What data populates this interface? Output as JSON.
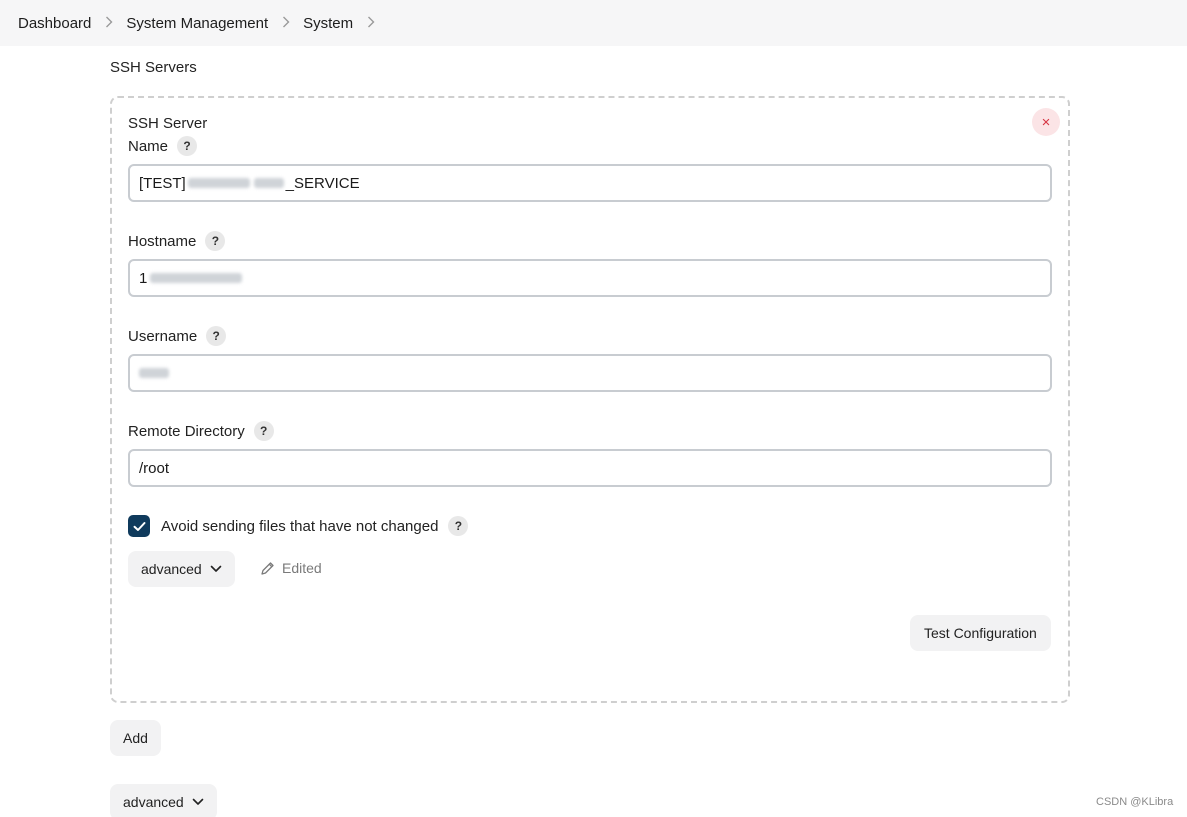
{
  "breadcrumb": {
    "items": [
      "Dashboard",
      "System Management",
      "System"
    ]
  },
  "section": {
    "title": "SSH Servers"
  },
  "server": {
    "heading": "SSH Server",
    "close_symbol": "×",
    "name": {
      "label": "Name",
      "value_prefix": "[TEST]",
      "value_suffix": "_SERVICE"
    },
    "hostname": {
      "label": "Hostname",
      "value_prefix": "1"
    },
    "username": {
      "label": "Username"
    },
    "remote_directory": {
      "label": "Remote Directory",
      "value": "/root"
    },
    "avoid_sending": {
      "label": "Avoid sending files that have not changed",
      "checked": true
    },
    "advanced_label": "advanced",
    "edited_label": "Edited",
    "test_button": "Test Configuration"
  },
  "help_symbol": "?",
  "add_button": "Add",
  "bottom_advanced_label": "advanced",
  "watermark": "CSDN @KLibra",
  "colors": {
    "checkbox": "#0f3a5c",
    "close_bg": "#fbe4e6",
    "close_fg": "#d63341",
    "breadcrumb_bg": "#f6f6f7"
  }
}
